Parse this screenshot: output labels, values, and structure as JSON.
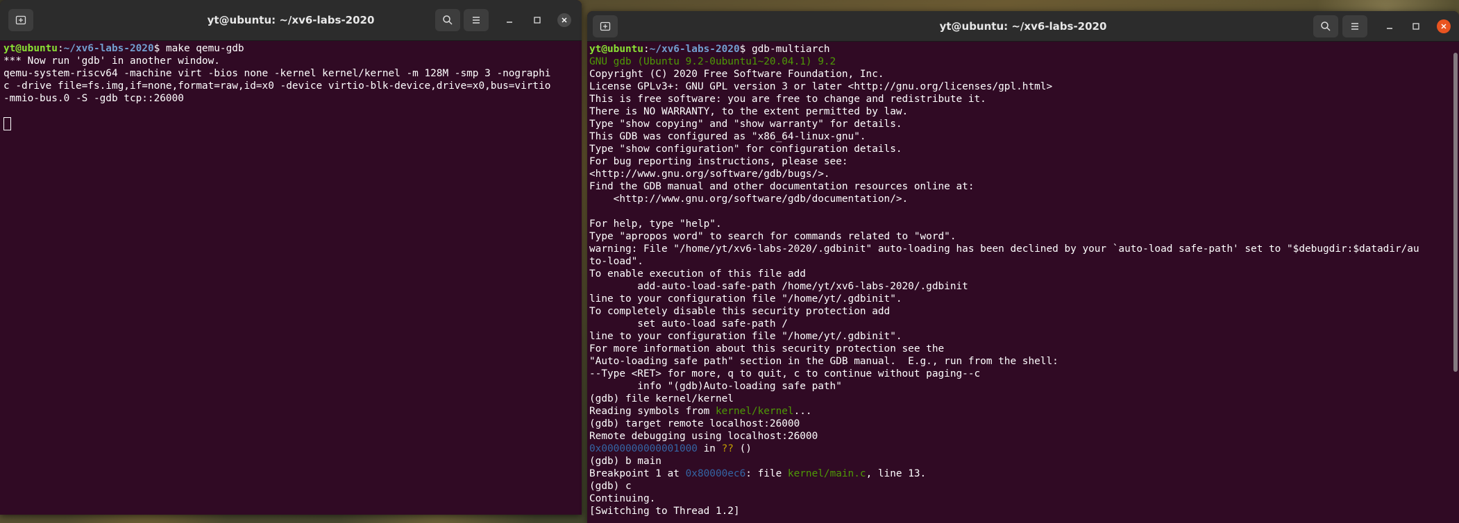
{
  "left_window": {
    "title": "yt@ubuntu: ~/xv6-labs-2020",
    "prompt_user": "yt@ubuntu",
    "prompt_sep": ":",
    "prompt_path": "~/xv6-labs-2020",
    "prompt_dollar": "$ ",
    "command": "make qemu-gdb",
    "output": [
      "*** Now run 'gdb' in another window.",
      "qemu-system-riscv64 -machine virt -bios none -kernel kernel/kernel -m 128M -smp 3 -nographi",
      "c -drive file=fs.img,if=none,format=raw,id=x0 -device virtio-blk-device,drive=x0,bus=virtio",
      "-mmio-bus.0 -S -gdb tcp::26000"
    ]
  },
  "right_window": {
    "title": "yt@ubuntu: ~/xv6-labs-2020",
    "prompt_user": "yt@ubuntu",
    "prompt_sep": ":",
    "prompt_path": "~/xv6-labs-2020",
    "prompt_dollar": "$ ",
    "command": "gdb-multiarch",
    "gdb_version": "GNU gdb (Ubuntu 9.2-0ubuntu1~20.04.1) 9.2",
    "lines_a": [
      "Copyright (C) 2020 Free Software Foundation, Inc.",
      "License GPLv3+: GNU GPL version 3 or later <http://gnu.org/licenses/gpl.html>",
      "This is free software: you are free to change and redistribute it.",
      "There is NO WARRANTY, to the extent permitted by law.",
      "Type \"show copying\" and \"show warranty\" for details.",
      "This GDB was configured as \"x86_64-linux-gnu\".",
      "Type \"show configuration\" for configuration details.",
      "For bug reporting instructions, please see:",
      "<http://www.gnu.org/software/gdb/bugs/>.",
      "Find the GDB manual and other documentation resources online at:",
      "    <http://www.gnu.org/software/gdb/documentation/>.",
      "",
      "For help, type \"help\".",
      "Type \"apropos word\" to search for commands related to \"word\".",
      "warning: File \"/home/yt/xv6-labs-2020/.gdbinit\" auto-loading has been declined by your `auto-load safe-path' set to \"$debugdir:$datadir/au",
      "to-load\".",
      "To enable execution of this file add",
      "        add-auto-load-safe-path /home/yt/xv6-labs-2020/.gdbinit",
      "line to your configuration file \"/home/yt/.gdbinit\".",
      "To completely disable this security protection add",
      "        set auto-load safe-path /",
      "line to your configuration file \"/home/yt/.gdbinit\".",
      "For more information about this security protection see the",
      "\"Auto-loading safe path\" section in the GDB manual.  E.g., run from the shell:",
      "--Type <RET> for more, q to quit, c to continue without paging--c",
      "        info \"(gdb)Auto-loading safe path\"",
      "(gdb) file kernel/kernel"
    ],
    "reading_pre": "Reading symbols from ",
    "reading_file": "kernel/kernel",
    "reading_post": "...",
    "target_cmd": "(gdb) target remote localhost:26000",
    "remote_msg": "Remote debugging using localhost:26000",
    "addr1": "0x0000000000001000",
    "addr1_mid": " in ",
    "addr1_q": "??",
    "addr1_post": " ()",
    "break_cmd": "(gdb) b main",
    "bp_pre": "Breakpoint 1 at ",
    "bp_addr": "0x80000ec6",
    "bp_mid": ": file ",
    "bp_file": "kernel/main.c",
    "bp_post": ", line 13.",
    "cont_cmd": "(gdb) c",
    "continuing": "Continuing.",
    "switching": "[Switching to Thread 1.2]"
  },
  "icons": {
    "new_tab": "new-tab-icon",
    "search": "search-icon",
    "menu": "hamburger-menu-icon",
    "minimize": "minimize-icon",
    "maximize": "maximize-icon",
    "close": "close-icon"
  }
}
